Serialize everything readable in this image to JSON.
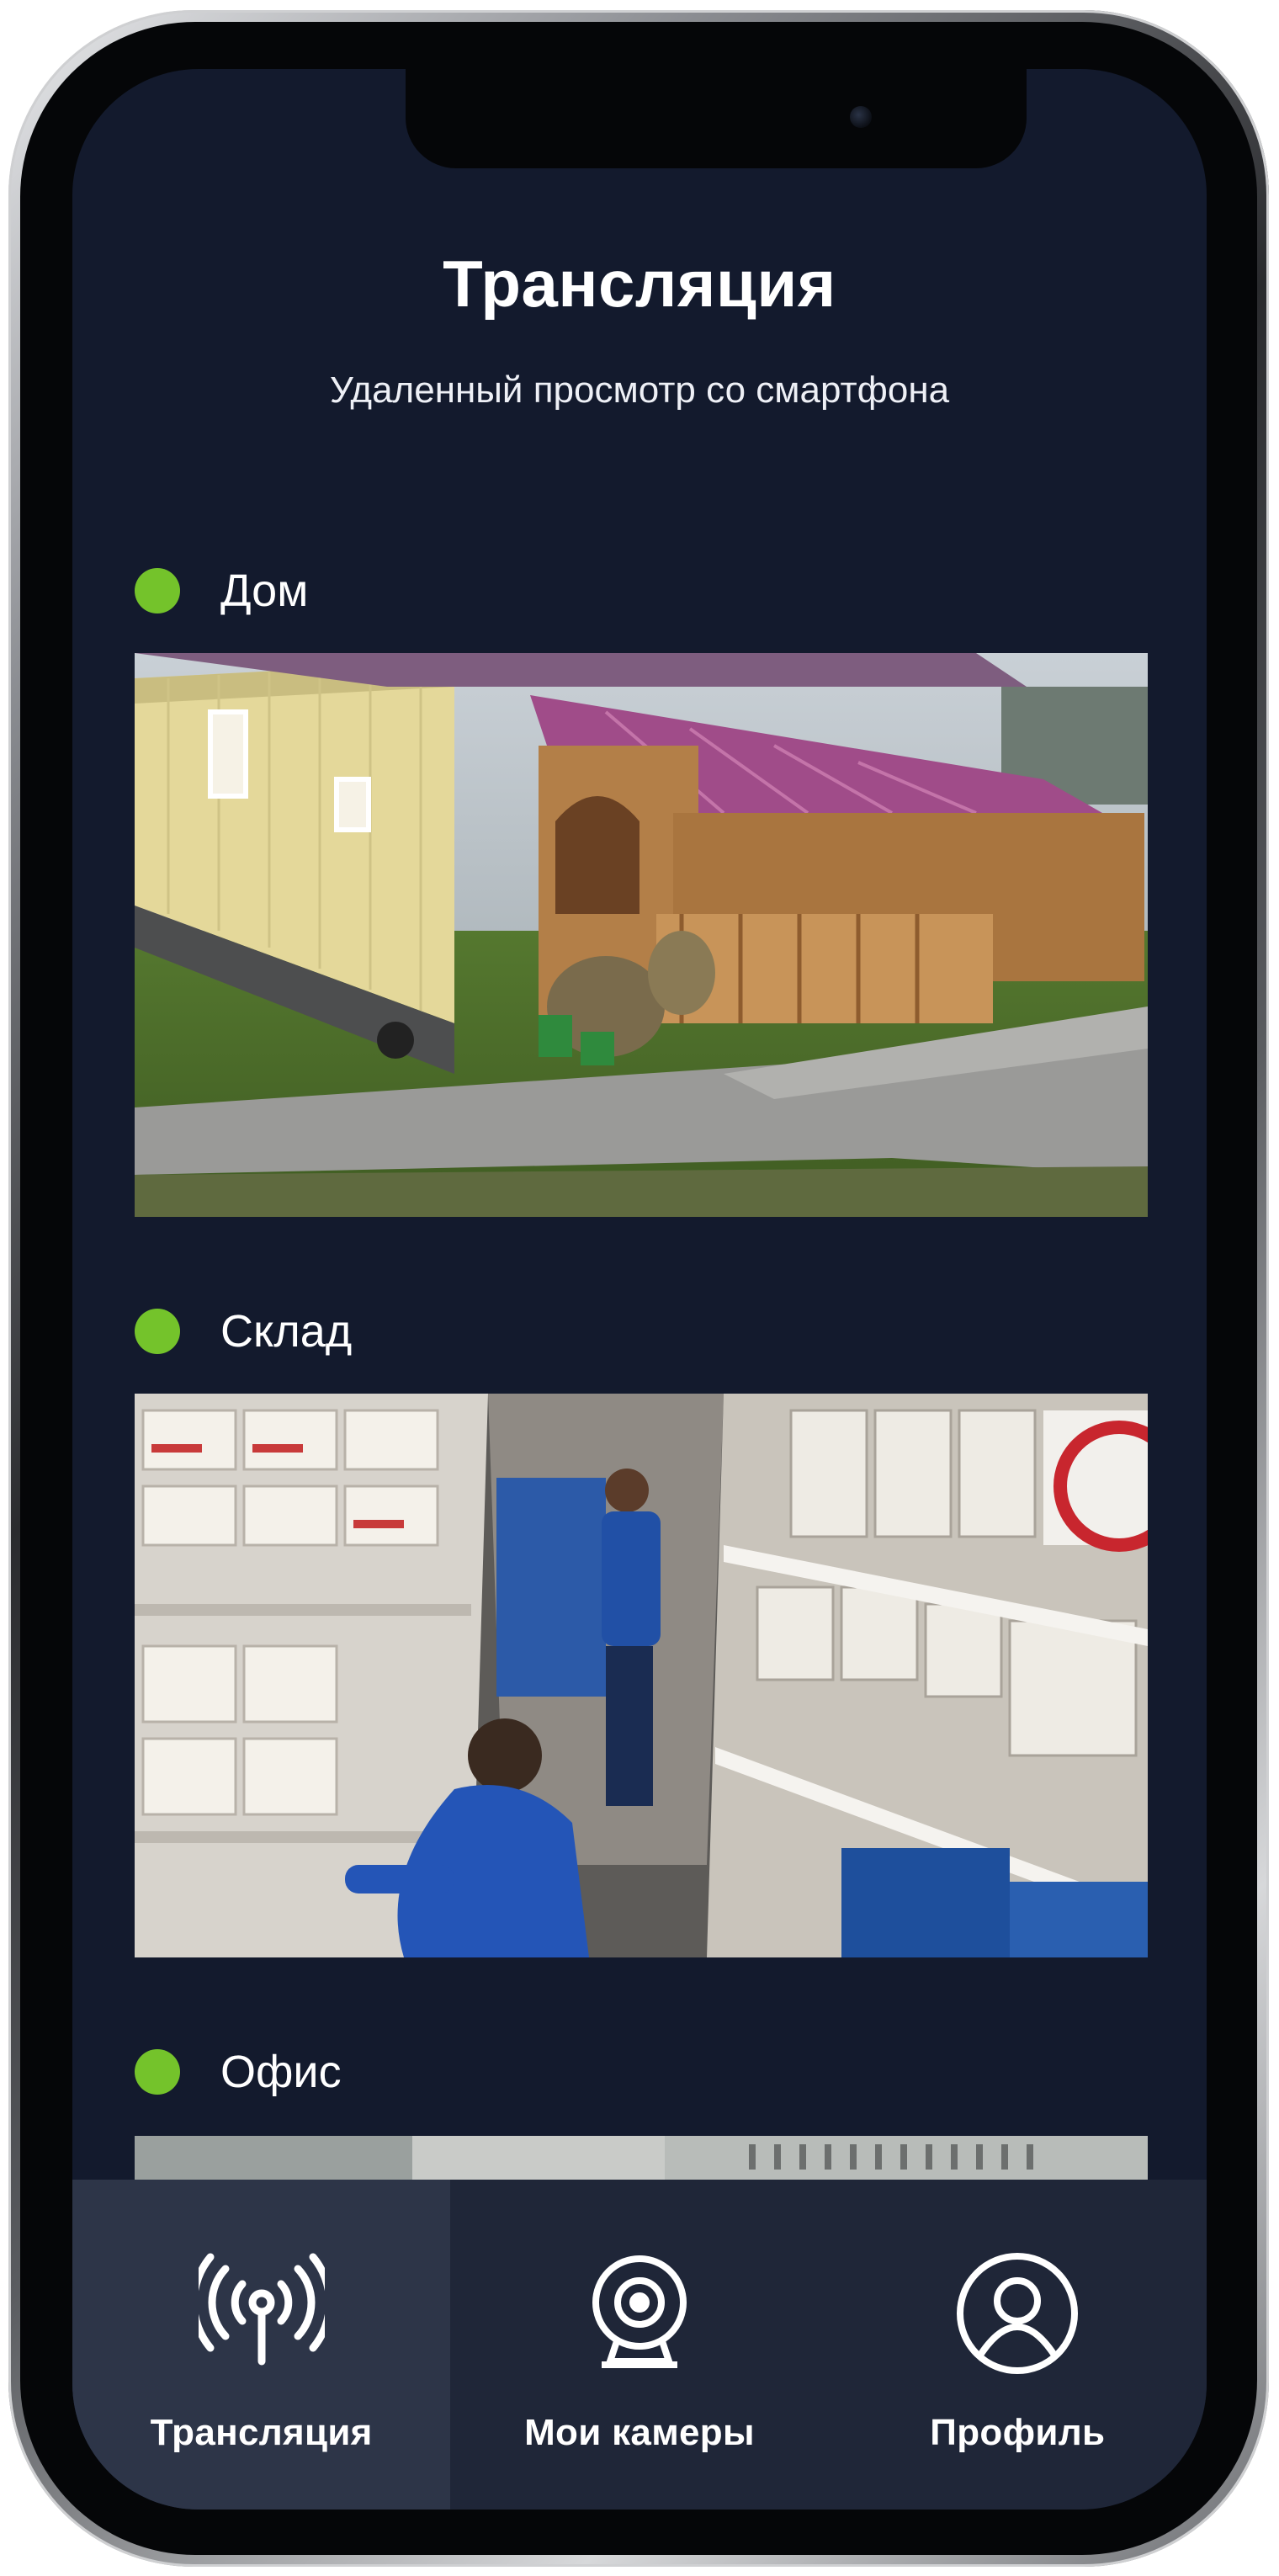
{
  "header": {
    "title": "Трансляция",
    "subtitle": "Удаленный просмотр со смартфона"
  },
  "feeds": [
    {
      "label": "Дом",
      "status": "online",
      "status_color": "#74c32b",
      "image": "house-with-veranda-camera-view"
    },
    {
      "label": "Склад",
      "status": "online",
      "status_color": "#74c32b",
      "image": "warehouse-shelves-workers-camera-view"
    },
    {
      "label": "Офис",
      "status": "online",
      "status_color": "#74c32b",
      "image": "office-camera-view"
    }
  ],
  "nav": {
    "items": [
      {
        "label": "Трансляция",
        "icon": "broadcast-antenna-icon",
        "active": true
      },
      {
        "label": "Мои камеры",
        "icon": "webcam-icon",
        "active": false
      },
      {
        "label": "Профиль",
        "icon": "user-profile-icon",
        "active": false
      }
    ]
  },
  "colors": {
    "background": "#131a2d",
    "nav_background": "#1f2638",
    "nav_active": "#2d3548",
    "status_online": "#74c32b",
    "text": "#ffffff"
  }
}
